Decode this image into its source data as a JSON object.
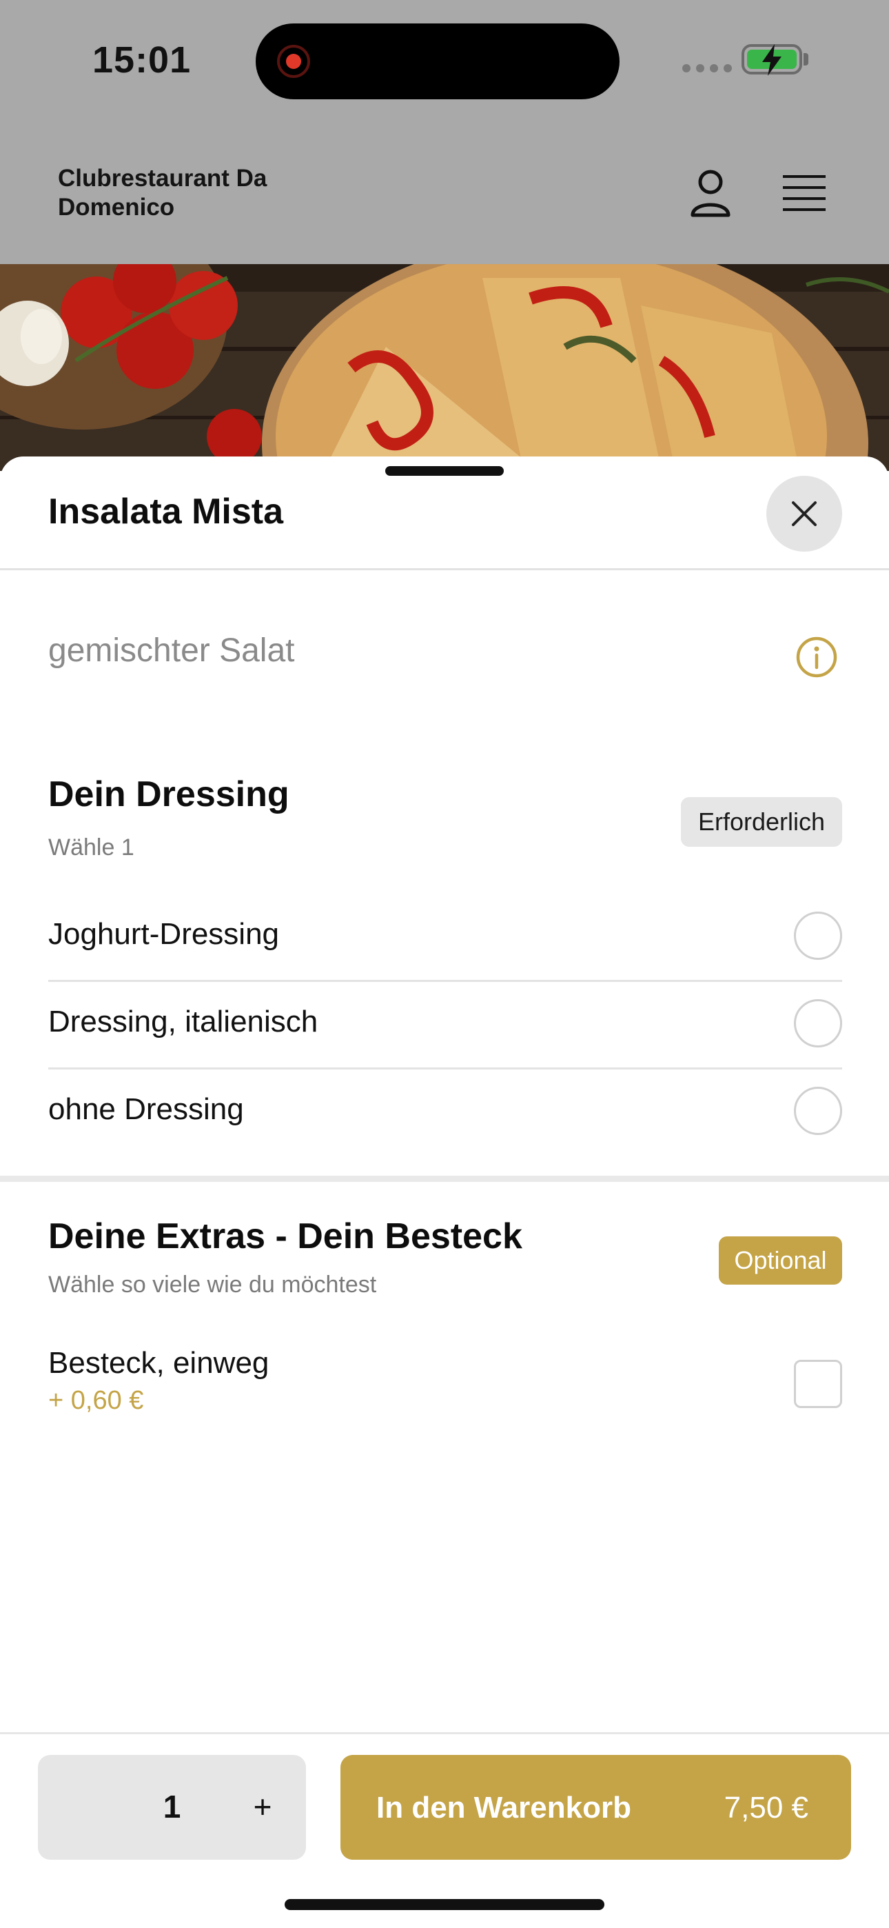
{
  "status_bar": {
    "time": "15:01"
  },
  "header": {
    "restaurant_name": "Clubrestaurant Da Domenico",
    "icons": [
      "user-icon",
      "hamburger-menu-icon"
    ]
  },
  "sheet": {
    "title": "Insalata Mista",
    "description": "gemischter Salat",
    "sections": [
      {
        "title": "Dein Dressing",
        "subtitle": "Wähle 1",
        "badge": "Erforderlich",
        "options": [
          {
            "label": "Joghurt-Dressing"
          },
          {
            "label": "Dressing, italienisch"
          },
          {
            "label": "ohne Dressing"
          }
        ]
      },
      {
        "title": "Deine Extras - Dein Besteck",
        "subtitle": "Wähle so viele wie du möchtest",
        "badge": "Optional",
        "options": [
          {
            "label": "Besteck, einweg",
            "price": "+ 0,60 €"
          }
        ]
      }
    ]
  },
  "footer": {
    "quantity": "1",
    "plus_label": "+",
    "add_to_cart_label": "In den Warenkorb",
    "total_price": "7,50 €"
  },
  "colors": {
    "accent": "#c4a447",
    "badge_required_bg": "#e6e6e6",
    "dim_overlay": "#a9a9a9"
  }
}
